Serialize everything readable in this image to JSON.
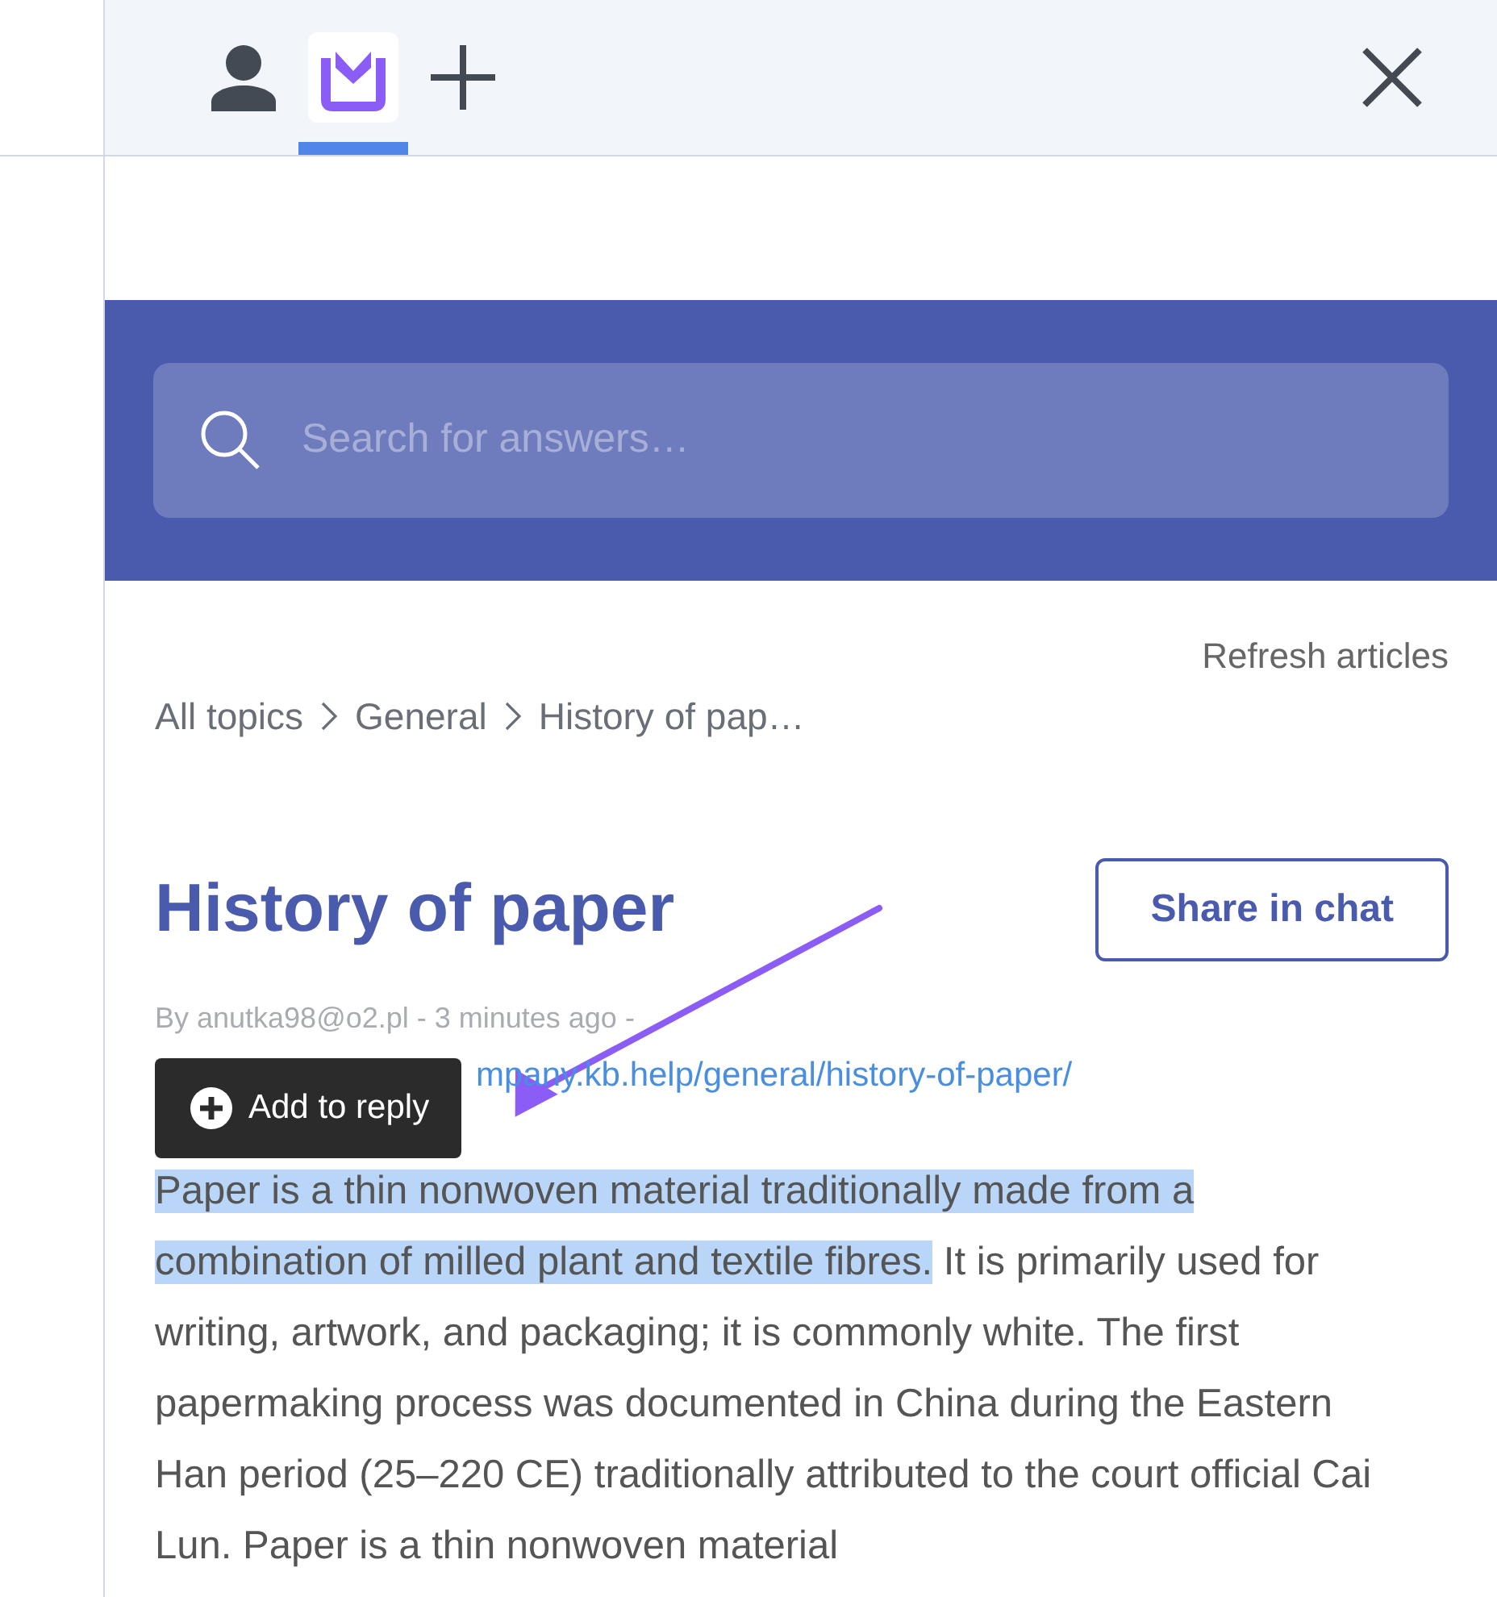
{
  "tabs": [
    {
      "kind": "person",
      "selected": false
    },
    {
      "kind": "logo",
      "selected": true
    },
    {
      "kind": "add",
      "selected": false
    }
  ],
  "search": {
    "placeholder": "Search for answers…"
  },
  "refresh": "Refresh articles",
  "breadcrumb": [
    "All topics",
    "General",
    "History of pap…"
  ],
  "article": {
    "title": "History of paper",
    "share_button": "Share in chat",
    "meta": "By anutka98@o2.pl - 3 minutes ago -",
    "link": "mpany.kb.help/general/history-of-paper/",
    "selected_text": "Paper is a thin nonwoven material traditionally made from a combination of milled plant and textile fibres.",
    "body": " It is primarily used for writing, artwork, and packaging; it is commonly white. The first papermaking process was documented in China during the Eastern Han period (25–220 CE) traditionally attributed to the court official Cai Lun. Paper is a thin nonwoven material"
  },
  "tooltip": {
    "label": "Add to reply"
  }
}
